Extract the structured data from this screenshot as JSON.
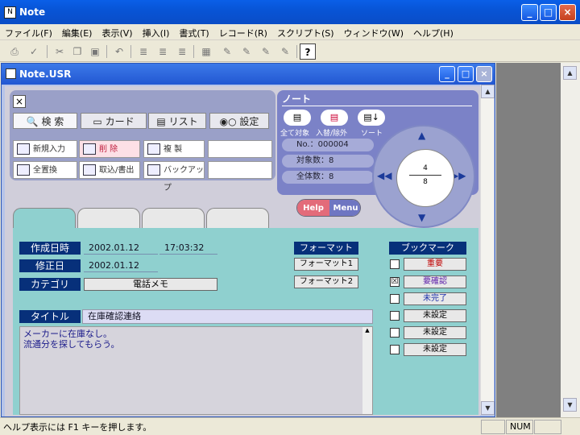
{
  "window": {
    "title": "Note"
  },
  "menu": [
    "ファイル(F)",
    "編集(E)",
    "表示(V)",
    "挿入(I)",
    "書式(T)",
    "レコード(R)",
    "スクリプト(S)",
    "ウィンドウ(W)",
    "ヘルプ(H)"
  ],
  "child": {
    "title": "Note.USR"
  },
  "nav_tabs": [
    "検 索",
    "カード",
    "リスト",
    "設定"
  ],
  "actions": [
    "新規入力",
    "削 除",
    "複 製",
    "全置換",
    "取込/書出",
    "バックアップ"
  ],
  "note": {
    "title": "ノート",
    "tools": [
      "全て対象",
      "入替/除外",
      "ソート"
    ],
    "no_label": "No.：",
    "no_value": "000004",
    "target_label": "対象数：",
    "target_value": "8",
    "total_label": "全体数：",
    "total_value": "8"
  },
  "dial": {
    "current": "4",
    "total": "8"
  },
  "help": {
    "help": "Help",
    "menu": "Menu"
  },
  "form": {
    "created_label": "作成日時",
    "created_date": "2002.01.12",
    "created_time": "17:03:32",
    "modified_label": "修正日",
    "modified_date": "2002.01.12",
    "category_label": "カテゴリ",
    "category_value": "電話メモ",
    "title_label": "タイトル",
    "title_value": "在庫確認連絡",
    "body_line1": "メーカーに在庫なし。",
    "body_line2": "流通分を探してもらう。"
  },
  "format": {
    "header": "フォーマット",
    "btn1": "フォーマット1",
    "btn2": "フォーマット2"
  },
  "bookmark": {
    "header": "ブックマーク",
    "items": [
      {
        "label": "重要",
        "checked": false,
        "color": "#c00000"
      },
      {
        "label": "要確認",
        "checked": true,
        "color": "#5a1aa8"
      },
      {
        "label": "未完了",
        "checked": false,
        "color": "#1a2fa8"
      },
      {
        "label": "未設定",
        "checked": false,
        "color": "#111111"
      },
      {
        "label": "未設定",
        "checked": false,
        "color": "#111111"
      },
      {
        "label": "未設定",
        "checked": false,
        "color": "#111111"
      }
    ],
    "check_mark": "☒"
  },
  "status": {
    "text": "ヘルプ表示には F1 キーを押します。",
    "num": "NUM"
  }
}
